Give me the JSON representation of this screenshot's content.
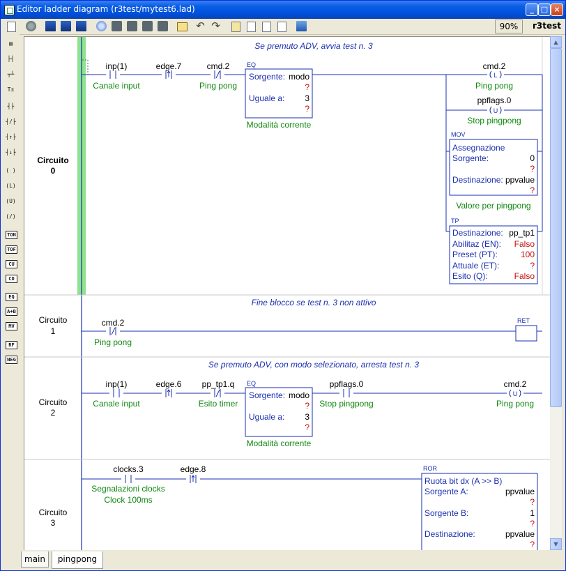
{
  "window": {
    "title": "Editor ladder diagram (r3test/mytest6.lad)",
    "zoom": "90%",
    "project": "r3test",
    "min_glyph": "_",
    "max_glyph": "□",
    "close_glyph": "×"
  },
  "sidebar": [
    {
      "icon": "coil-normal-icon",
      "text": "( )"
    },
    {
      "icon": "coil-latch-icon",
      "text": "(L)"
    },
    {
      "icon": "coil-unlatch-icon",
      "text": "(U)"
    },
    {
      "icon": "coil-negated-icon",
      "text": "(/)"
    },
    {
      "icon": "ton-icon",
      "text": "TON"
    },
    {
      "icon": "tof-icon",
      "text": "TOF"
    },
    {
      "icon": "ctu-icon",
      "text": "CU"
    },
    {
      "icon": "ctd-icon",
      "text": "CD"
    },
    {
      "icon": "eq-block-icon",
      "text": "EQ"
    },
    {
      "icon": "add-block-icon",
      "text": "A+B"
    },
    {
      "icon": "mov-block-icon",
      "text": "MV"
    },
    {
      "icon": "rof-block-icon",
      "text": "RF"
    },
    {
      "icon": "neg-block-icon",
      "text": "NEG"
    }
  ],
  "tabs": [
    {
      "label": "main",
      "active": false
    },
    {
      "label": "pingpong",
      "active": true
    }
  ],
  "colors": {
    "wire": "#1a2fb0",
    "comment": "#1a2fb0",
    "label": "#118811",
    "unknown": "#c01010",
    "rail_power": "#8fe38f"
  },
  "rungs": [
    {
      "label": "Circuito",
      "number": "0",
      "comment": "Se premuto ADV, avvia test n. 3",
      "c1_top": "inp(1)",
      "c1_bot": "Canale input",
      "c2_top": "edge.7",
      "c3_top": "cmd.2",
      "c3_bot": "Ping pong",
      "eq_type": "EQ",
      "eq_src_label": "Sorgente:",
      "eq_src_val": "modo",
      "eq_q": "?",
      "eq_eq_label": "Uguale a:",
      "eq_eq_val": "3",
      "eq_q2": "?",
      "eq_bot": "Modalità corrente",
      "coil1_top": "cmd.2",
      "coil1_bot": "Ping pong",
      "coil2_top": "ppflags.0",
      "coil2_bot": "Stop pingpong",
      "mov_type": "MOV",
      "mov_title": "Assegnazione",
      "mov_src_label": "Sorgente:",
      "mov_src_val": "0",
      "mov_q1": "?",
      "mov_dst_label": "Destinazione:",
      "mov_dst_val": "ppvalue",
      "mov_q2": "?",
      "mov_bot": "Valore per pingpong",
      "tp_type": "TP",
      "tp_dst_label": "Destinazione:",
      "tp_dst_val": "pp_tp1",
      "tp_en_label": "Abilitaz (EN):",
      "tp_en_val": "Falso",
      "tp_pt_label": "Preset (PT):",
      "tp_pt_val": "100",
      "tp_et_label": "Attuale (ET):",
      "tp_et_val": "?",
      "tp_q_label": "Esito (Q):",
      "tp_q_val": "Falso"
    },
    {
      "label": "Circuito",
      "number": "1",
      "comment": "Fine blocco se test n. 3 non attivo",
      "c1_top": "cmd.2",
      "c1_bot": "Ping pong",
      "ret_type": "RET"
    },
    {
      "label": "Circuito",
      "number": "2",
      "comment": "Se premuto ADV, con modo selezionato, arresta test n. 3",
      "c1_top": "inp(1)",
      "c1_bot": "Canale input",
      "c2_top": "edge.6",
      "c3_top": "pp_tp1.q",
      "c3_bot": "Esito timer",
      "eq_type": "EQ",
      "eq_src_label": "Sorgente:",
      "eq_src_val": "modo",
      "eq_q": "?",
      "eq_eq_label": "Uguale a:",
      "eq_eq_val": "3",
      "eq_q2": "?",
      "eq_bot": "Modalità corrente",
      "c4_top": "ppflags.0",
      "c4_bot": "Stop pingpong",
      "coil1_top": "cmd.2",
      "coil1_bot": "Ping pong"
    },
    {
      "label": "Circuito",
      "number": "3",
      "c1_top": "clocks.3",
      "c1_bot": "Segnalazioni clocks",
      "c1_bot2": "Clock 100ms",
      "c2_top": "edge.8",
      "ror_type": "ROR",
      "ror_title": "Ruota bit dx (A >> B)",
      "ror_a_label": "Sorgente A:",
      "ror_a_val": "ppvalue",
      "ror_q1": "?",
      "ror_b_label": "Sorgente B:",
      "ror_b_val": "1",
      "ror_q2": "?",
      "ror_d_label": "Destinazione:",
      "ror_d_val": "ppvalue",
      "ror_q3": "?"
    }
  ]
}
